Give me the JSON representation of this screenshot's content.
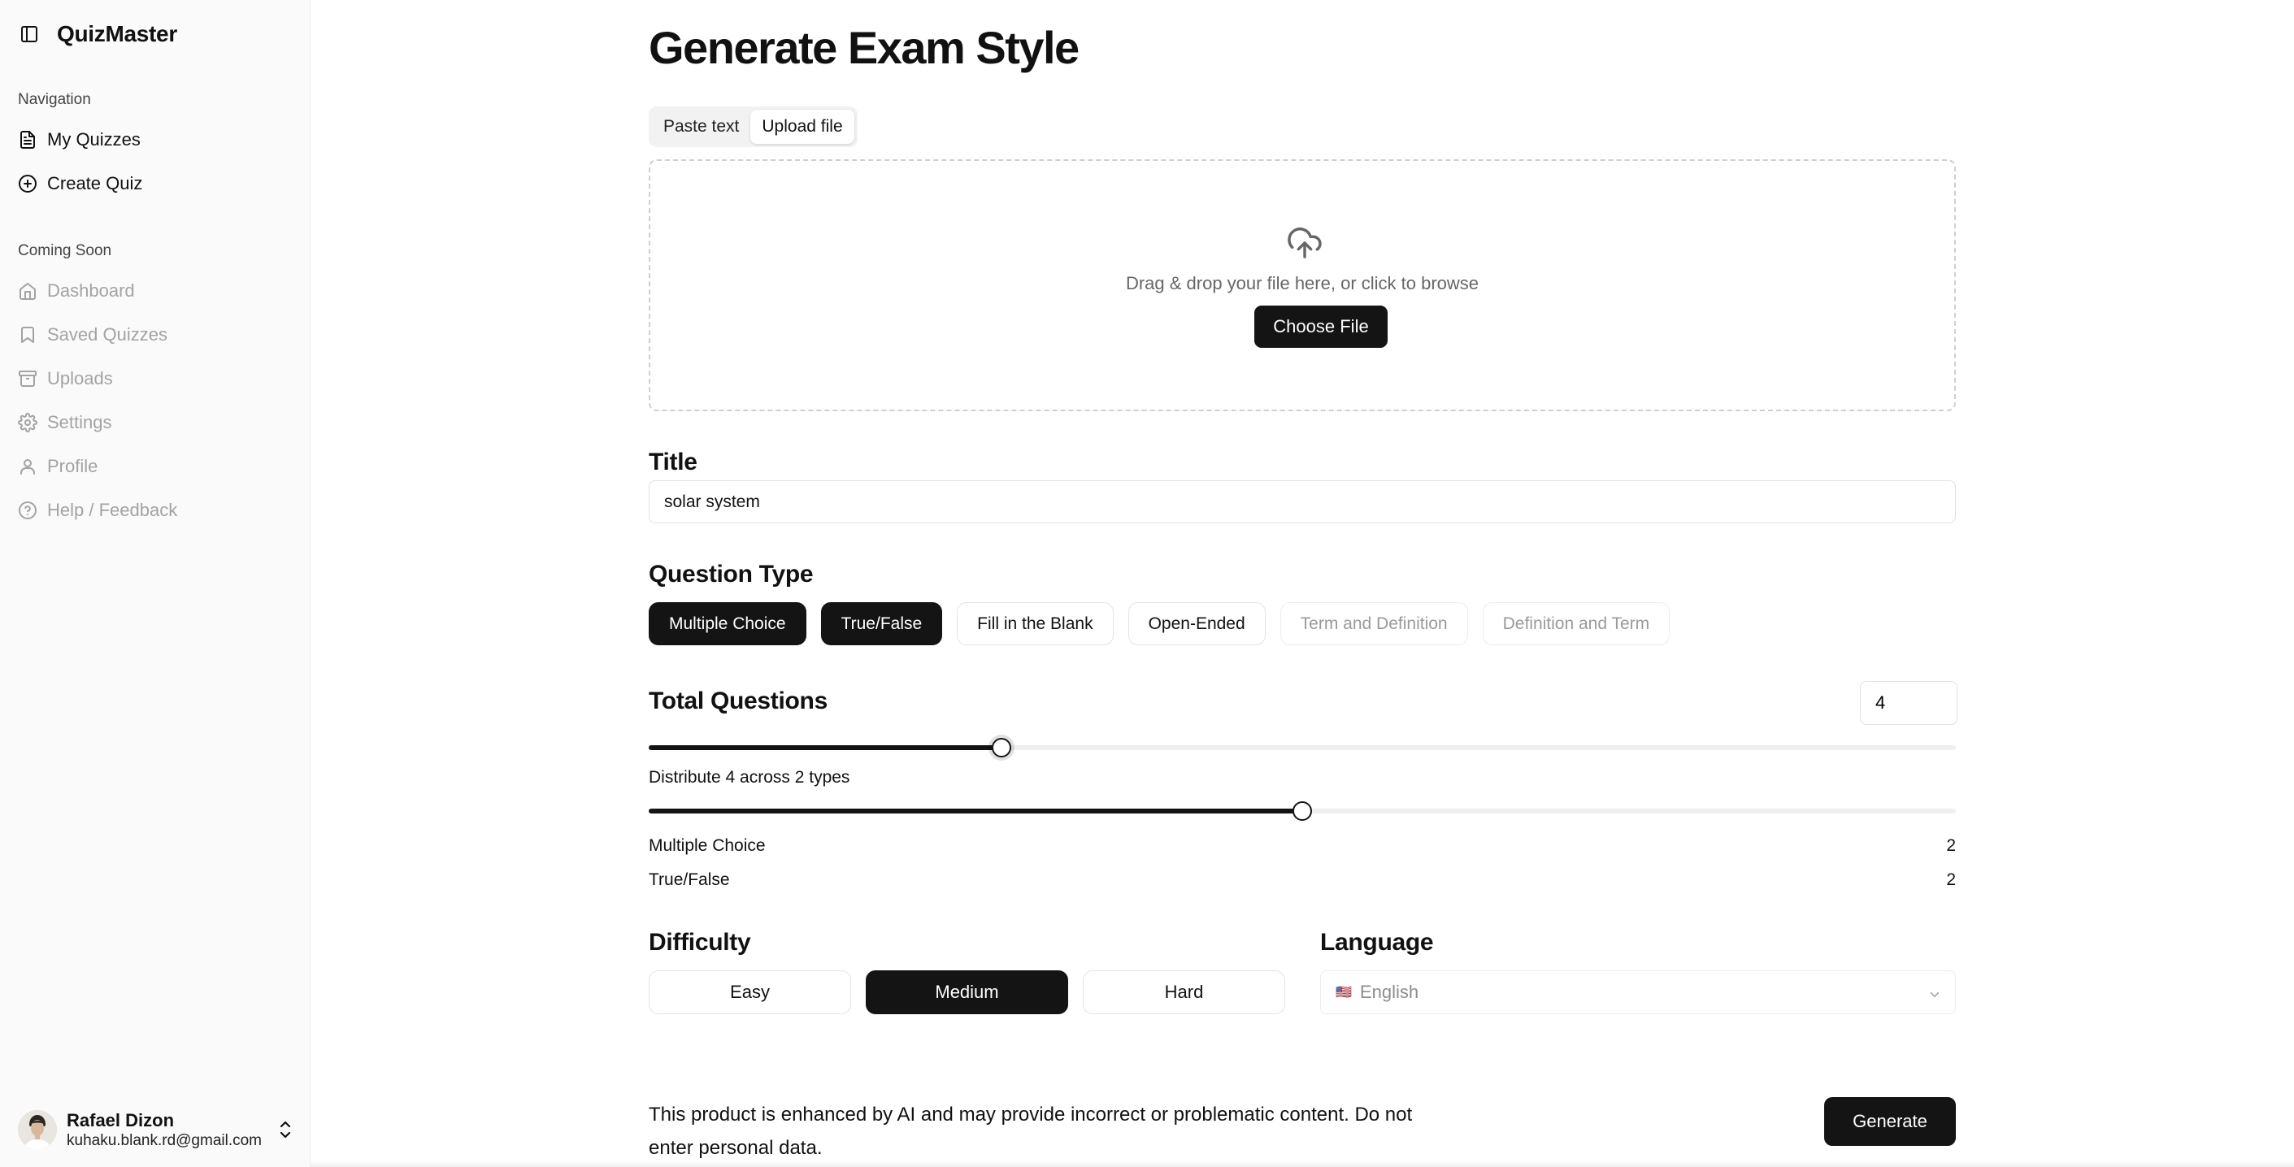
{
  "app": {
    "name": "QuizMaster"
  },
  "sidebar": {
    "navigation_label": "Navigation",
    "navigation": [
      {
        "label": "My Quizzes",
        "icon": "file-text-icon"
      },
      {
        "label": "Create Quiz",
        "icon": "plus-circle-icon"
      }
    ],
    "coming_soon_label": "Coming Soon",
    "coming_soon": [
      {
        "label": "Dashboard",
        "icon": "home-icon"
      },
      {
        "label": "Saved Quizzes",
        "icon": "bookmark-icon"
      },
      {
        "label": "Uploads",
        "icon": "archive-icon"
      },
      {
        "label": "Settings",
        "icon": "gear-icon"
      },
      {
        "label": "Profile",
        "icon": "user-icon"
      },
      {
        "label": "Help / Feedback",
        "icon": "help-circle-icon"
      }
    ],
    "user": {
      "name": "Rafael Dizon",
      "email": "kuhaku.blank.rd@gmail.com"
    }
  },
  "page": {
    "title": "Generate Exam Style",
    "tabs": [
      {
        "label": "Paste text",
        "active": false
      },
      {
        "label": "Upload file",
        "active": true
      }
    ],
    "upload": {
      "text": "Drag & drop your file here, or click to browse",
      "button": "Choose File"
    },
    "title_field": {
      "label": "Title",
      "value": "solar system"
    },
    "question_type": {
      "label": "Question Type",
      "options": [
        {
          "label": "Multiple Choice",
          "state": "selected"
        },
        {
          "label": "True/False",
          "state": "selected"
        },
        {
          "label": "Fill in the Blank",
          "state": "available"
        },
        {
          "label": "Open-Ended",
          "state": "available"
        },
        {
          "label": "Term and Definition",
          "state": "disabled"
        },
        {
          "label": "Definition and Term",
          "state": "disabled"
        }
      ]
    },
    "total_questions": {
      "label": "Total Questions",
      "value": "4",
      "slider_fraction": 0.27
    },
    "distribution": {
      "text": "Distribute 4 across 2 types",
      "slider_fraction": 0.5,
      "rows": [
        {
          "label": "Multiple Choice",
          "count": "2"
        },
        {
          "label": "True/False",
          "count": "2"
        }
      ]
    },
    "difficulty": {
      "label": "Difficulty",
      "options": [
        "Easy",
        "Medium",
        "Hard"
      ],
      "selected": "Medium"
    },
    "language": {
      "label": "Language",
      "value": "English",
      "flag": "🇺🇸"
    },
    "disclaimer": "This product is enhanced by AI and may provide incorrect or problematic content. Do not enter personal data.",
    "generate_button": "Generate"
  },
  "colors": {
    "primary": "#141414",
    "muted": "#a3a3a3",
    "border": "#e3e3e3",
    "sidebar_bg": "#fafafa"
  }
}
